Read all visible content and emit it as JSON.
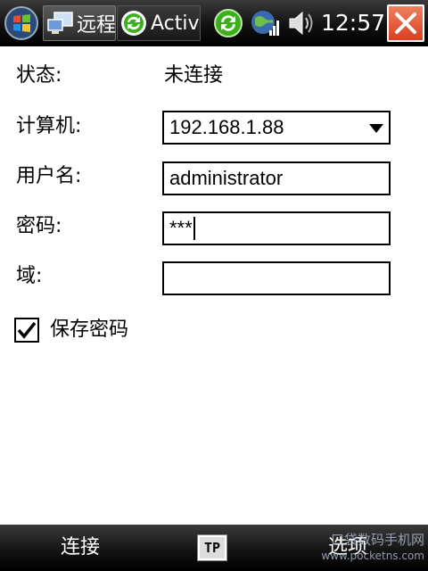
{
  "titlebar": {
    "tasks": [
      {
        "label": "远程",
        "icon": "remote-desktop-icon"
      },
      {
        "label": "ActiveSync",
        "icon": "activesync-icon"
      }
    ],
    "tray_icons": [
      "sync-icon",
      "network-signal-icon",
      "volume-icon"
    ],
    "clock": "12:57",
    "close_icon": "close-icon"
  },
  "form": {
    "status": {
      "label": "状态:",
      "value": "未连接"
    },
    "computer": {
      "label": "计算机:",
      "value": "192.168.1.88"
    },
    "username": {
      "label": "用户名:",
      "value": "administrator"
    },
    "password": {
      "label": "密码:",
      "value": "***"
    },
    "domain": {
      "label": "域:",
      "value": ""
    },
    "save_password": {
      "label": "保存密码",
      "checked": true
    }
  },
  "softkeys": {
    "left": "连接",
    "center_icon": "tp-input-icon",
    "center_text": "TP",
    "right": "选项"
  },
  "watermark": {
    "line1": "口袋数码手机网",
    "line2": "www.pocketns.com"
  },
  "colors": {
    "bar_dark": "#111111",
    "close_red": "#e05030",
    "sync_green": "#3cb01c"
  }
}
